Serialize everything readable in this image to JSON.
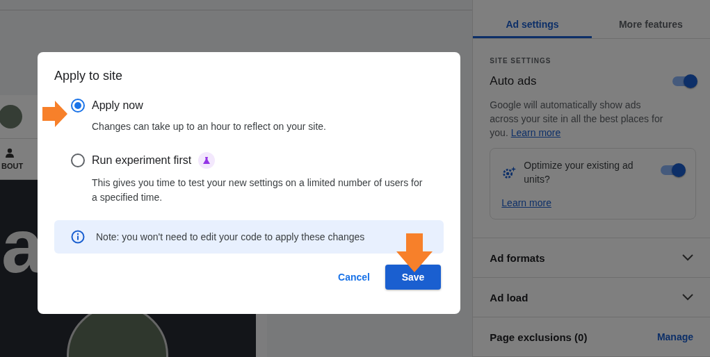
{
  "preview": {
    "nav_label": "BOUT",
    "hero_letter": "a"
  },
  "side_panel": {
    "tabs": [
      {
        "label": "Ad settings",
        "selected": true
      },
      {
        "label": "More features",
        "selected": false
      }
    ],
    "section_heading": "SITE SETTINGS",
    "auto_ads": {
      "label": "Auto ads",
      "on": true,
      "description": "Google will automatically show ads across your site in all the best places for you.",
      "link": "Learn more"
    },
    "optimize_card": {
      "label": "Optimize your existing ad units?",
      "on": true,
      "link": "Learn more"
    },
    "sections": [
      {
        "label": "Ad formats",
        "kind": "expand"
      },
      {
        "label": "Ad load",
        "kind": "expand"
      },
      {
        "label": "Page exclusions (0)",
        "kind": "manage",
        "action": "Manage"
      }
    ]
  },
  "dialog": {
    "title": "Apply to site",
    "options": [
      {
        "label": "Apply now",
        "description": "Changes can take up to an hour to reflect on your site.",
        "selected": true,
        "badge": false
      },
      {
        "label": "Run experiment first",
        "description": "This gives you time to test your new settings on a limited number of users for a specified time.",
        "selected": false,
        "badge": true
      }
    ],
    "note": "Note: you won't need to edit your code to apply these changes",
    "buttons": [
      {
        "label": "Cancel",
        "kind": "text"
      },
      {
        "label": "Save",
        "kind": "primary"
      }
    ]
  }
}
